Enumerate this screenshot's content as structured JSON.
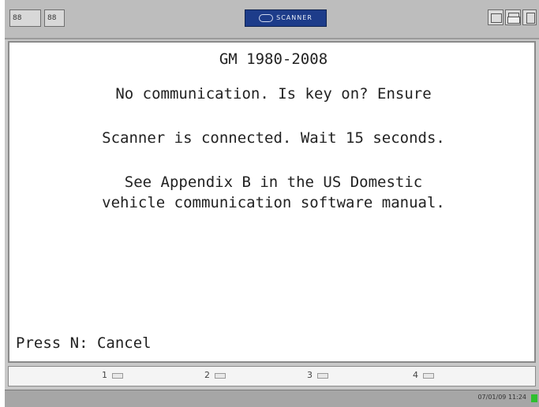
{
  "topbar": {
    "left_button_1": "88",
    "left_button_2": "88",
    "logo_text": "SCANNER"
  },
  "screen": {
    "title": "GM 1980-2008",
    "lines": [
      "No communication. Is key on? Ensure",
      "Scanner is connected. Wait 15 seconds.",
      "See Appendix B in the US Domestic",
      "vehicle communication software manual."
    ],
    "prompt": "Press N: Cancel"
  },
  "function_keys": [
    "1",
    "2",
    "3",
    "4"
  ],
  "status": {
    "datetime": "07/01/09  11:24",
    "indicator_color": "#2fbf2f"
  }
}
